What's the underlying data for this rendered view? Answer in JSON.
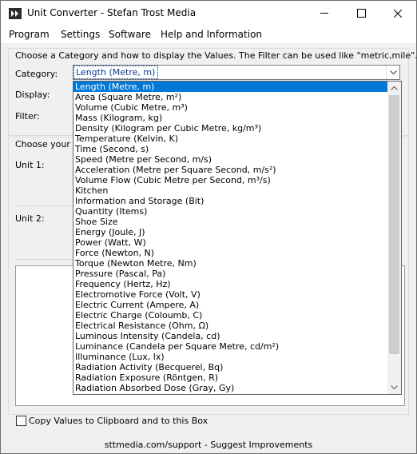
{
  "window": {
    "title": "Unit Converter - Stefan Trost Media",
    "icon": "app-icon"
  },
  "menu": [
    "Program",
    "Settings",
    "Software",
    "Help and Information"
  ],
  "intro_text": "Choose a Category and how to display the Values. The Filter can be used like \"metric,mile\".",
  "labels": {
    "category": "Category:",
    "display": "Display:",
    "filter": "Filter:",
    "choose_values": "Choose your Va",
    "unit1": "Unit 1:",
    "unit2": "Unit 2:"
  },
  "category_combo": {
    "selected": "Length (Metre, m)"
  },
  "category_options": [
    "Length (Metre, m)",
    "Area (Square Metre, m²)",
    "Volume (Cubic Metre, m³)",
    "Mass (Kilogram, kg)",
    "Density (Kilogram per Cubic Metre, kg/m³)",
    "Temperature (Kelvin, K)",
    "Time (Second, s)",
    "Speed (Metre per Second, m/s)",
    "Acceleration (Metre per Square Second, m/s²)",
    "Volume Flow (Cubic Metre per Second, m³/s)",
    "Kitchen",
    "Information and Storage (Bit)",
    "Quantity (Items)",
    "Shoe Size",
    "Energy (Joule, J)",
    "Power (Watt, W)",
    "Force (Newton, N)",
    "Torque (Newton Metre, Nm)",
    "Pressure (Pascal, Pa)",
    "Frequency (Hertz, Hz)",
    "Electromotive Force (Volt, V)",
    "Electric Current (Ampere, A)",
    "Electric Charge (Coloumb, C)",
    "Electrical Resistance (Ohm, Ω)",
    "Luminous Intensity (Candela, cd)",
    "Luminance (Candela per Square Metre, cd/m²)",
    "Illuminance (Lux, lx)",
    "Radiation Activity (Becquerel, Bq)",
    "Radiation Exposure (Röntgen, R)",
    "Radiation Absorbed Dose (Gray, Gy)"
  ],
  "checkbox": {
    "label": "Copy Values to Clipboard and to this Box",
    "checked": false
  },
  "footer": "sttmedia.com/support - Suggest Improvements",
  "colors": {
    "selection": "#0078d7",
    "window_bg": "#f0f0f0"
  }
}
